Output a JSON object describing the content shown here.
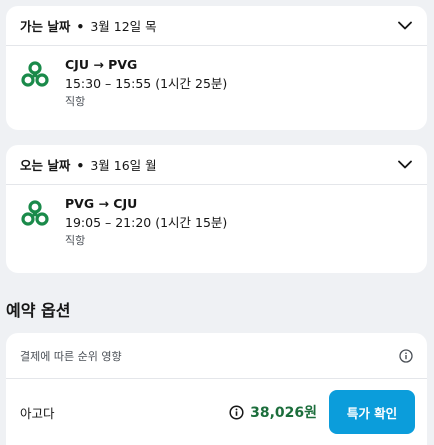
{
  "outbound": {
    "label": "가는 날짜",
    "separator": "•",
    "date": "3월 12일 목",
    "route": "CJU → PVG",
    "times": "15:30 – 15:55 (1시간 25분)",
    "stops": "직항",
    "airline_icon": "airline-logo-icon"
  },
  "inbound": {
    "label": "오는 날짜",
    "separator": "•",
    "date": "3월 16일 월",
    "route": "PVG → CJU",
    "times": "19:05 – 21:20 (1시간 15분)",
    "stops": "직항",
    "airline_icon": "airline-logo-icon"
  },
  "booking": {
    "title": "예약 옵션",
    "ranking_note": "결제에 따른 순위 영향",
    "options": [
      {
        "provider": "아고다",
        "price": "38,026원",
        "button": "특가 확인"
      }
    ]
  },
  "colors": {
    "airline_logo": "#1a8a4a",
    "price": "#1c6e3c",
    "button_bg": "#0b9ddb",
    "page_bg": "#eff1f4"
  }
}
